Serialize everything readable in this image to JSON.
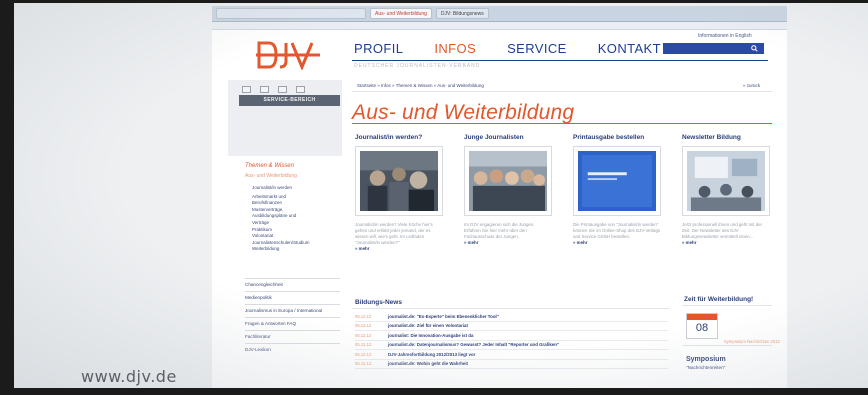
{
  "watermark": "www.djv.de",
  "browser": {
    "tabs": [
      {
        "label": "Aus- und Weiterbildung",
        "active": true
      },
      {
        "label": "DJV: Bildungsnews",
        "active": false
      }
    ]
  },
  "site": {
    "logo_text": "DJV",
    "tagline": "DEUTSCHER JOURNALISTEN-VERBAND",
    "lang_link": "Informationen in English",
    "nav": [
      "PROFIL",
      "INFOS",
      "SERVICE",
      "KONTAKT"
    ],
    "nav_active_index": 1,
    "colors": {
      "brand_blue": "#1d3f8f",
      "accent_orange": "#e2572c"
    }
  },
  "sidebar": {
    "service_label": "SERVICE-BEREICH",
    "section_title": "Themen & Wissen",
    "section_sub": "Aus- und Weiterbildung",
    "items": [
      "Journalist/in werden",
      "Arbeitsmarkt und",
      "Berufsfinanzen",
      "Musterverträge,",
      "Ausbildungspläne und",
      "Verträge",
      "Praktikum",
      "Volontariat",
      "Journalistenschulen/Studium",
      "Weiterbildung"
    ],
    "main_items": [
      "Chancengleichheit",
      "Medienpolitik",
      "Journalismus in Europa / International",
      "Fragen & Antworten FAQ",
      "Fachliteratur",
      "DJV-Lexikon"
    ]
  },
  "main": {
    "breadcrumb": "Startseite » Infos » Themen & Wissen » Aus- und Weiterbildung",
    "back_link": "« zurück",
    "title": "Aus- und Weiterbildung",
    "columns": [
      {
        "heading": "Journalist/in werden?",
        "text": "Journalist/in werden? Viele Köche hier's gehen und erklärt jeder jemand, der es wissen will, wie's geht. Im Leitfaden \"Journalist/in werden?\"",
        "more": "» mehr"
      },
      {
        "heading": "Junge Journalisten",
        "text": "Im DJV engagieren sich die Jungen. Erfahren Sie hier mehr über den Fachausschuss der Jungen.",
        "more": "» mehr"
      },
      {
        "heading": "Printausgabe bestellen",
        "text": "Die Printausgabe von \"Journalist/in werden\" können Sie im Online-Shop des DJV-Verlags und Service GmbH bestellen.",
        "more": "» mehr"
      },
      {
        "heading": "Newsletter Bildung",
        "text": "Jetzt professionell ihnen und geht mit der Zeit. Der Newsletter des DJV Bildungsnewsletter vermittelt einen...",
        "more": "» mehr"
      }
    ],
    "news_heading": "Bildungs-News",
    "news": [
      {
        "date": "05.12.12",
        "text": "journalist.de: \"Ex-Experte\" beim Ebenenklicher Tool\""
      },
      {
        "date": "05.12.12",
        "text": "journalist.de: Ziel für einen Volontariat"
      },
      {
        "date": "05.12.12",
        "text": "journalist: Die Innovation-Ausgabe ist da"
      },
      {
        "date": "05.12.12",
        "text": "journalist.de: Datenjournalismus? Gewusst? Jeder Inhalt \"Reporter und Grafiken\""
      },
      {
        "date": "05.12.12",
        "text": "DJV-Jahresfortbildung 2012/2013 liegt vor"
      },
      {
        "date": "05.12.12",
        "text": "journalist.de: Wohin geht die Wahrheit"
      }
    ],
    "zeit_heading": "Zeit für Weiterbildung!",
    "calendar_day": "08",
    "calendar_note": "Symposium Nachrichten 2012",
    "symposium_title": "Symposium",
    "symposium_sub": "\"Nachrichtenreiten\""
  }
}
